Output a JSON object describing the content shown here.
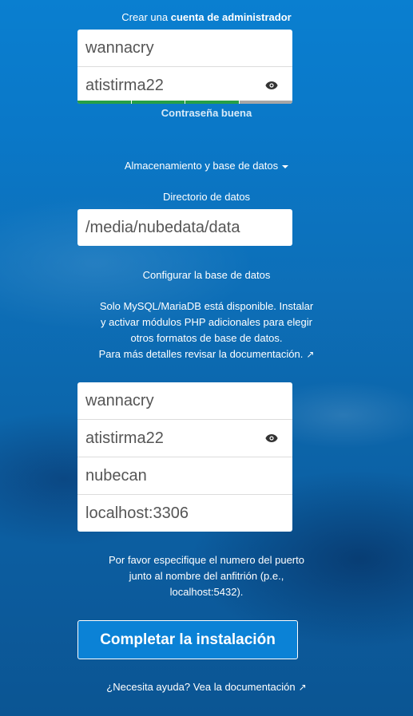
{
  "header": {
    "title_prefix": "Crear una ",
    "title_bold": "cuenta de administrador"
  },
  "admin": {
    "username_value": "wannacry",
    "password_value": "atistirma22",
    "strength_label": "Contraseña buena",
    "strength_colors": [
      "#27a046",
      "#27a046",
      "#27a046",
      "#a6a6a6"
    ]
  },
  "storage": {
    "toggle_label": "Almacenamiento y base de datos",
    "data_dir_label": "Directorio de datos",
    "data_dir_value": "/media/nubedata/data"
  },
  "database": {
    "section_label": "Configurar la base de datos",
    "info_line1": "Solo MySQL/MariaDB está disponible. Instalar",
    "info_line2": "y activar módulos PHP adicionales para elegir",
    "info_line3": "otros formatos de base de datos.",
    "info_link": "Para más detalles revisar la documentación.",
    "user_value": "wannacry",
    "password_value": "atistirma22",
    "name_value": "nubecan",
    "host_value": "localhost:3306",
    "hint_line1": "Por favor especifique el numero del puerto",
    "hint_line2": "junto al nombre del anfitrión (p.e.,",
    "hint_line3": "localhost:5432)."
  },
  "actions": {
    "submit_label": "Completar la instalación",
    "help_link": "¿Necesita ayuda? Vea la documentación"
  },
  "icons": {
    "eye": "eye-icon",
    "external": "external-link-icon"
  }
}
